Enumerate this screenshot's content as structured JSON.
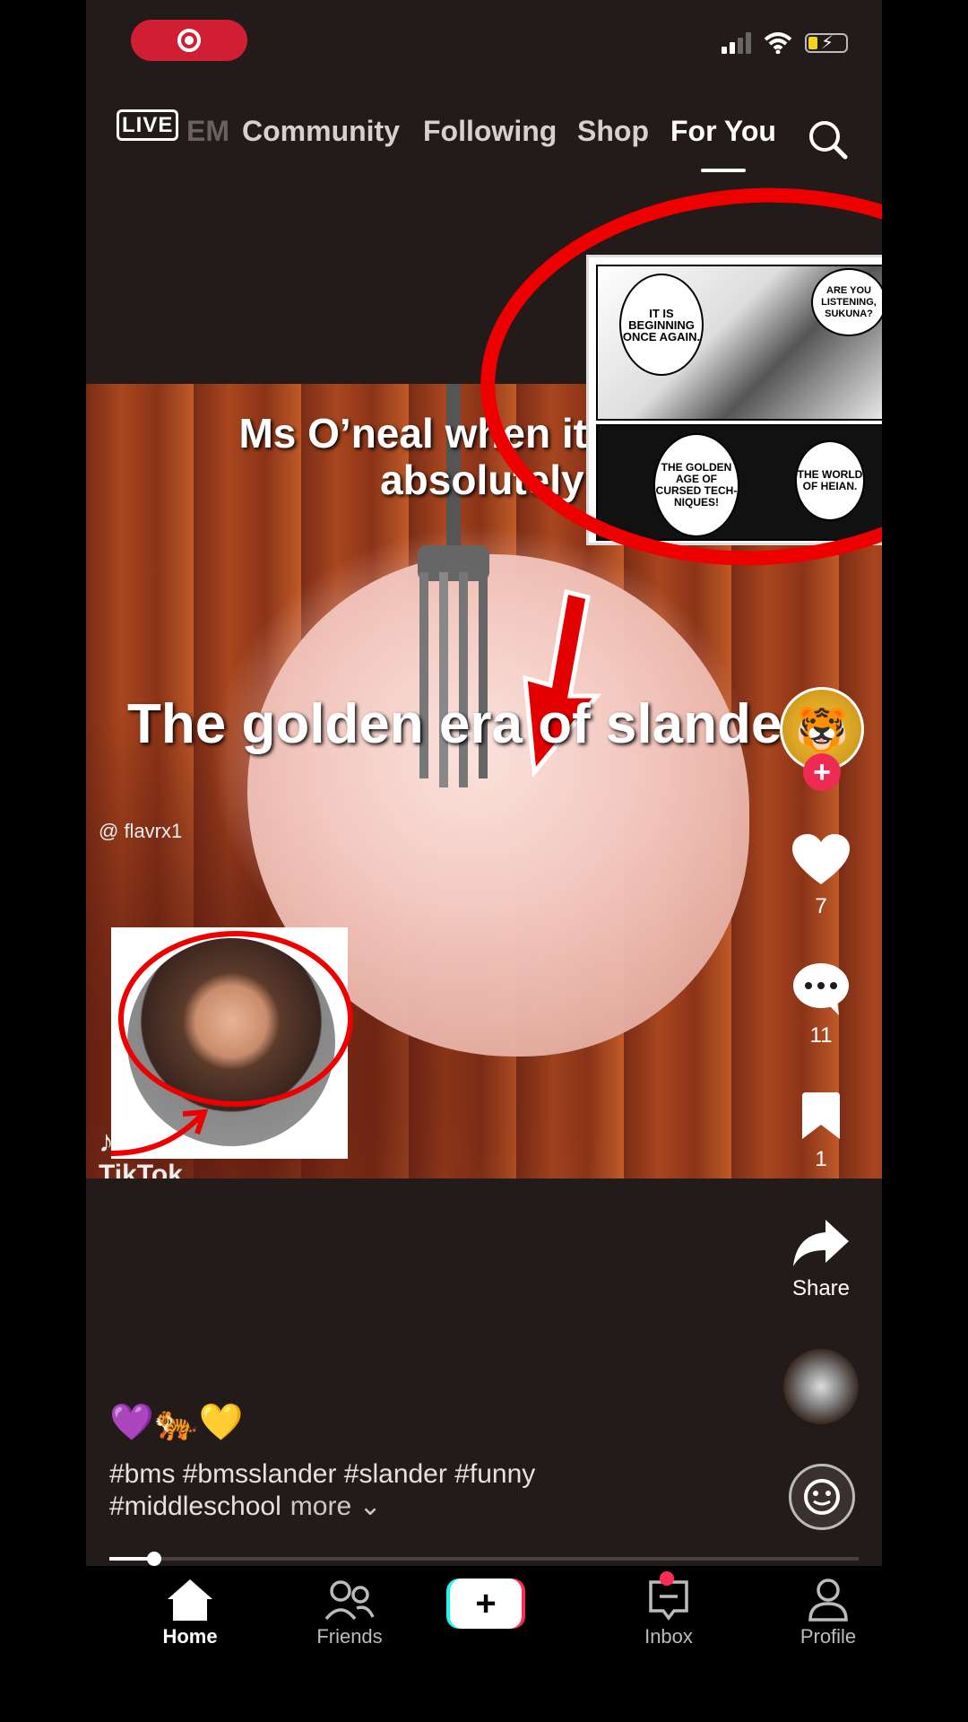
{
  "status_bar": {
    "recording_label": ""
  },
  "top_nav": {
    "live_label": "LIVE",
    "tabs": [
      {
        "label": "EM"
      },
      {
        "label": "Community"
      },
      {
        "label": "Following"
      },
      {
        "label": "Shop"
      },
      {
        "label": "For You"
      }
    ],
    "active_tab": "For You"
  },
  "video": {
    "caption_line1": "Ms O’neal when it comes",
    "caption_line2": "absolutely not",
    "caption_main": "The golden era of slander",
    "watermark_brand": "TikTok",
    "watermark_handle": "@ flavrx1",
    "manga_bubbles": [
      "IT IS BEGINNING ONCE AGAIN.",
      "ARE YOU LISTENING, SUKUNA?",
      "THE GOLDEN AGE OF CURSED TECH-NIQUES!",
      "THE WORLD OF HEIAN."
    ]
  },
  "right_rail": {
    "likes": "7",
    "comments": "11",
    "bookmarks": "1",
    "share_label": "Share",
    "icons": [
      "heart-icon",
      "comment-icon",
      "bookmark-icon",
      "share-icon"
    ]
  },
  "caption": {
    "emojis": "💜🐅💛",
    "hashtags": "#bms #bmsslander #slander #funny #middleschool",
    "more_label": "more"
  },
  "playback": {
    "progress": 0.06
  },
  "bottom_nav": {
    "items": [
      {
        "label": "Home"
      },
      {
        "label": "Friends"
      },
      {
        "label": ""
      },
      {
        "label": "Inbox"
      },
      {
        "label": "Profile"
      }
    ]
  },
  "colors": {
    "accent": "#fe2c55",
    "cyan": "#25f4ee",
    "bg": "#231a1a"
  }
}
